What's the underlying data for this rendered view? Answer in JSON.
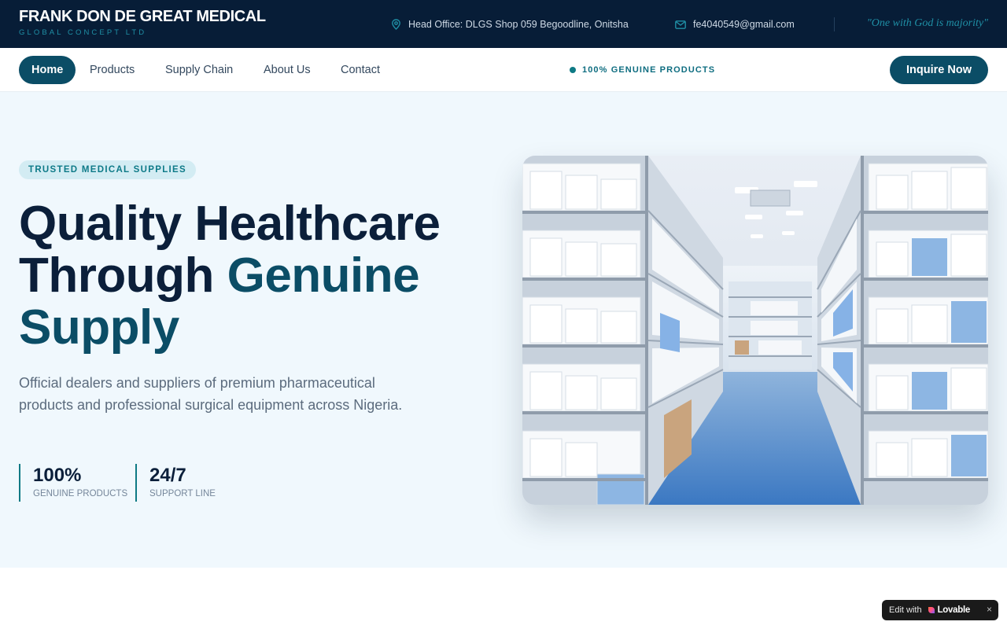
{
  "brand": {
    "name": "FRANK DON DE GREAT MEDICAL",
    "subtitle": "GLOBAL CONCEPT LTD"
  },
  "topbar": {
    "office": "Head Office: DLGS Shop 059 Begoodline, Onitsha",
    "office_icon": "map-pin-icon",
    "email": "fe4040549@gmail.com",
    "email_icon": "mail-icon",
    "motto": "\"One with God is majority\""
  },
  "nav": {
    "items": [
      "Home",
      "Products",
      "Supply Chain",
      "About Us",
      "Contact"
    ],
    "active": "Home",
    "badge": "100% GENUINE PRODUCTS",
    "cta": "Inquire Now"
  },
  "hero": {
    "badge": "TRUSTED MEDICAL SUPPLIES",
    "title_line1": "Quality Healthcare",
    "title_line2a": "Through ",
    "title_line2b": "Genuine",
    "title_line3": "Supply",
    "description": "Official dealers and suppliers of premium pharmaceutical products and professional surgical equipment across Nigeria.",
    "stats": [
      {
        "value": "100%",
        "label": "GENUINE PRODUCTS"
      },
      {
        "value": "24/7",
        "label": "SUPPORT LINE"
      }
    ],
    "image_icon": "warehouse-photo"
  },
  "lovable": {
    "prefix": "Edit with",
    "name": "Lovable",
    "close": "×"
  },
  "colors": {
    "navy": "#071d37",
    "teal": "#0b4d66",
    "accent": "#1f8fa5",
    "hero_bg": "#f0f8fd"
  }
}
